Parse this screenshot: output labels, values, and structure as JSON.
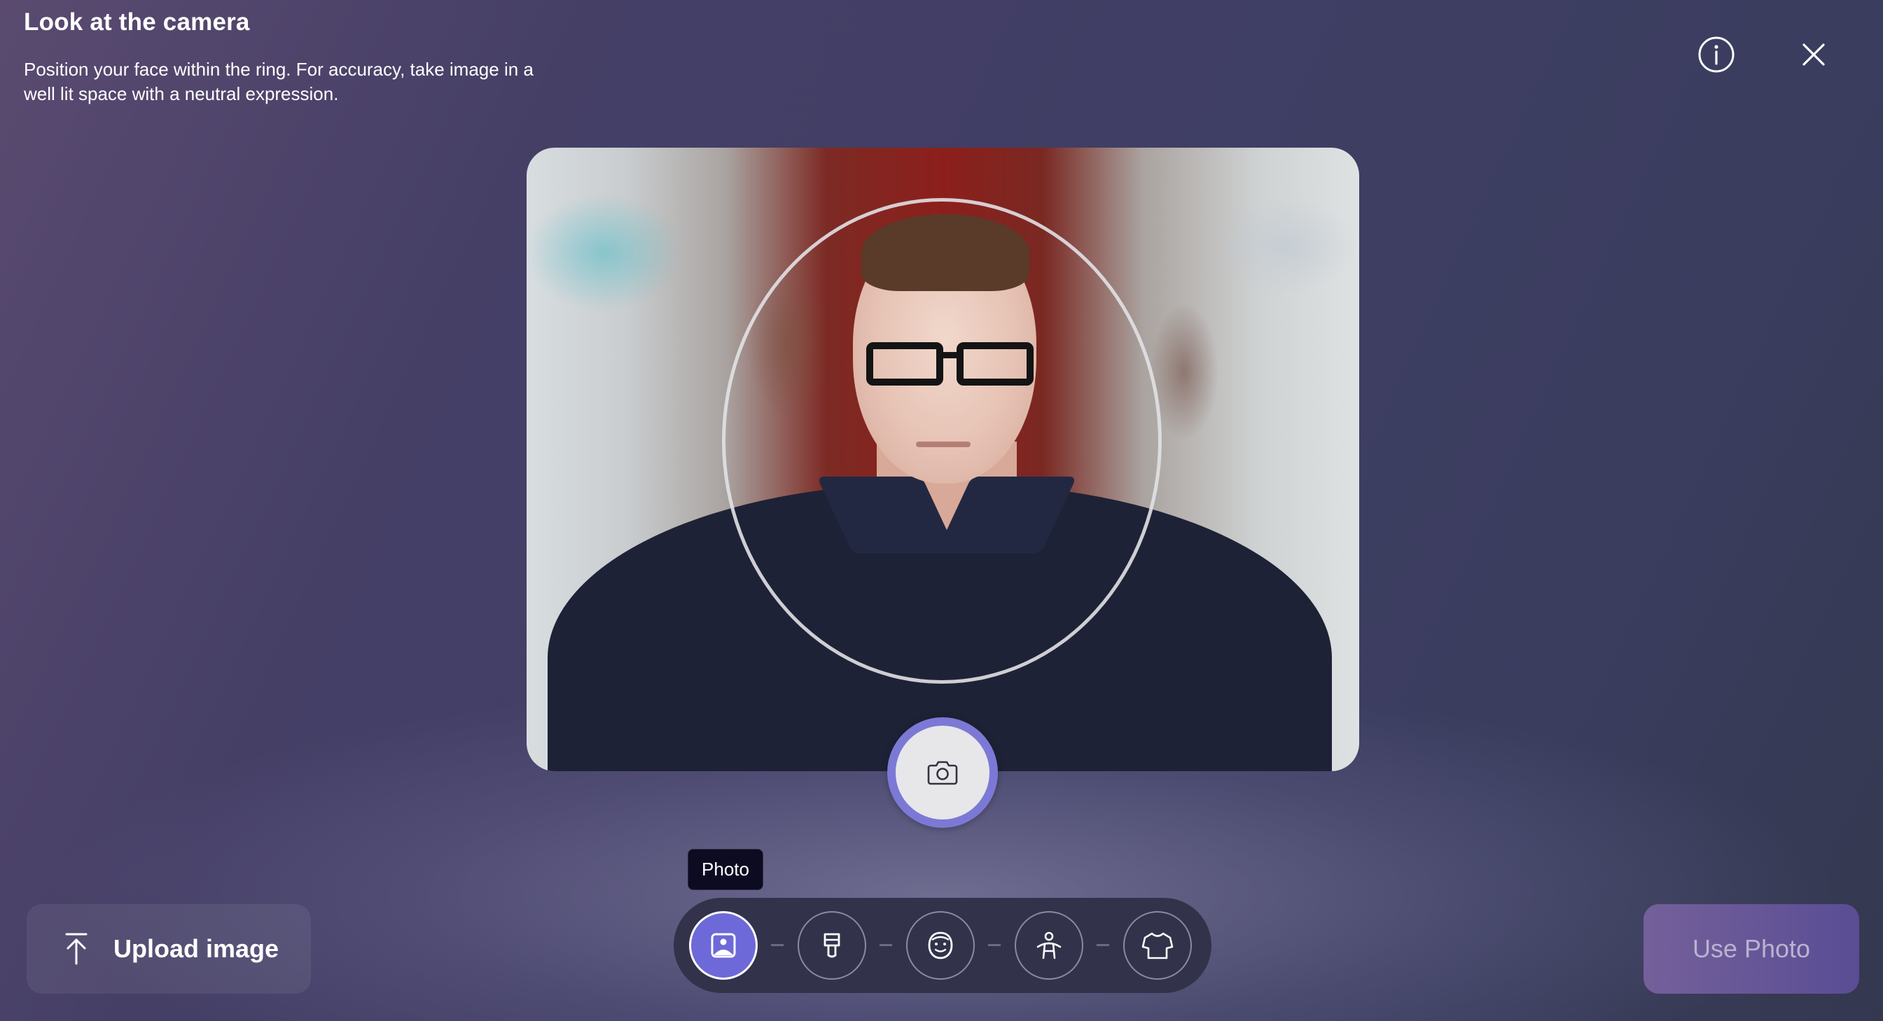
{
  "header": {
    "title": "Look at the camera",
    "subtitle": "Position your face within the ring. For accuracy, take image in a well lit space with a neutral expression."
  },
  "icons": {
    "info": "info-icon",
    "close": "close-icon",
    "capture": "camera-icon",
    "upload": "upload-arrow-icon"
  },
  "steps": {
    "tooltip": "Photo",
    "items": [
      {
        "id": "photo",
        "icon": "photo-icon",
        "active": true
      },
      {
        "id": "nails",
        "icon": "nail-polish-icon",
        "active": false
      },
      {
        "id": "face",
        "icon": "face-icon",
        "active": false
      },
      {
        "id": "body",
        "icon": "body-icon",
        "active": false
      },
      {
        "id": "clothing",
        "icon": "shirt-icon",
        "active": false
      }
    ]
  },
  "actions": {
    "upload_label": "Upload image",
    "use_photo_label": "Use Photo"
  },
  "colors": {
    "accent": "#6e69d8",
    "capture_ring": "#7c79d6",
    "use_photo_bg": "#6a589a",
    "tooltip_bg": "#0c0b22"
  }
}
